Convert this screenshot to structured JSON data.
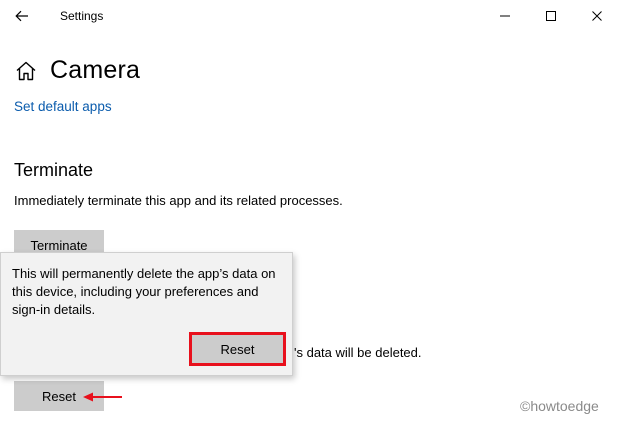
{
  "window": {
    "title": "Settings",
    "controls": {
      "minimize": "minimize-icon",
      "maximize": "maximize-icon",
      "close": "close-icon"
    }
  },
  "page": {
    "title": "Camera",
    "link_text": "Set default apps"
  },
  "terminate_section": {
    "title": "Terminate",
    "description": "Immediately terminate this app and its related processes.",
    "button_label": "Terminate"
  },
  "reset_section": {
    "partial_description": "'s data will be deleted.",
    "button_label": "Reset"
  },
  "flyout": {
    "message": "This will permanently delete the app’s data on this device, including your preferences and sign-in details.",
    "confirm_label": "Reset"
  },
  "watermark": "©howtoedge",
  "colors": {
    "link": "#0b5cad",
    "button_bg": "#cccccc",
    "highlight": "#e8101c",
    "flyout_bg": "#f2f2f2"
  }
}
